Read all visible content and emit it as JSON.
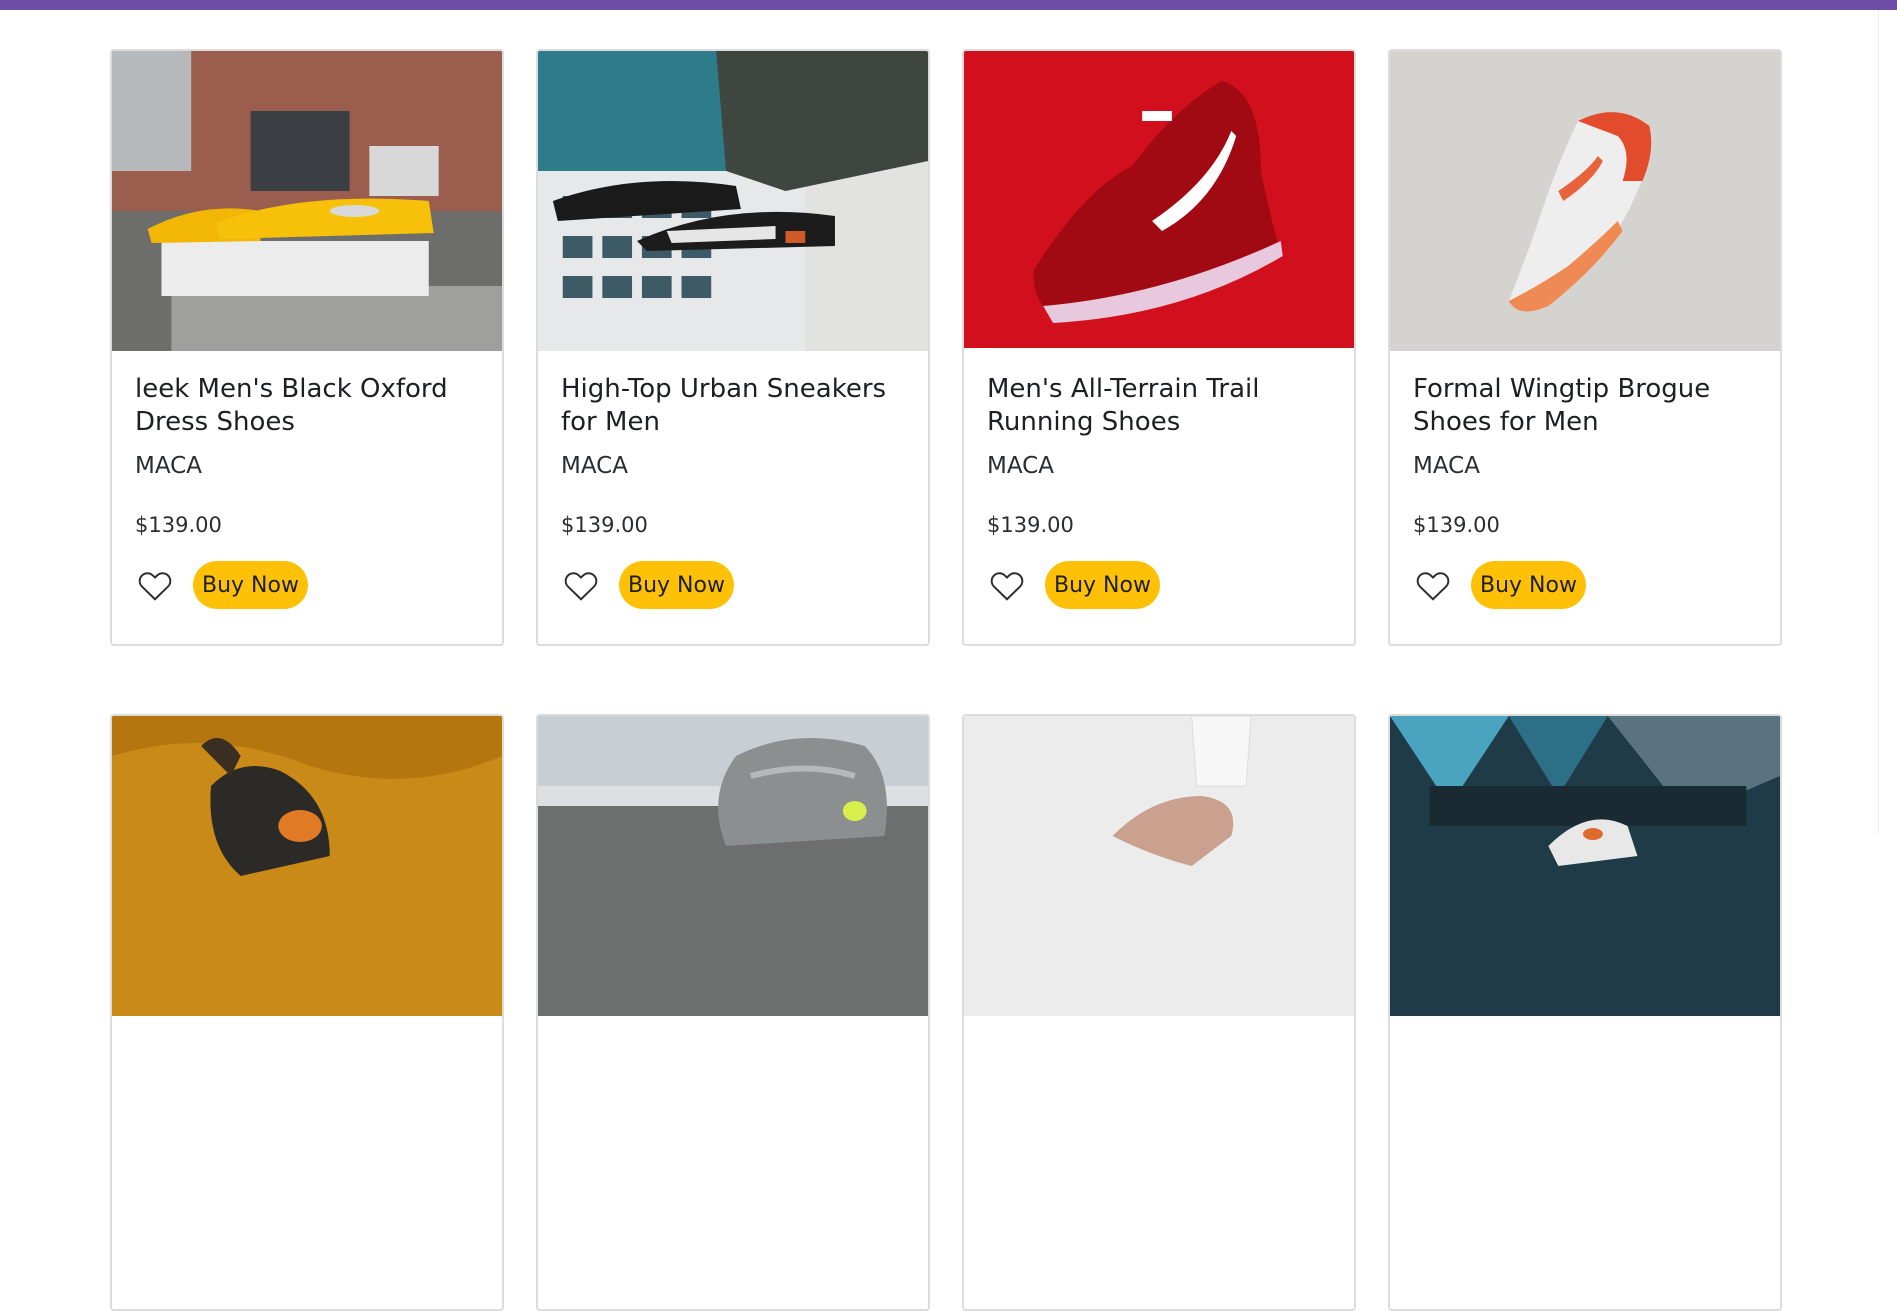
{
  "colors": {
    "topbar": "#6f4ca5",
    "button": "#ffc107",
    "card_border": "#dcdcdc"
  },
  "products": [
    {
      "title": "leek Men's Black Oxford Dress Shoes",
      "brand": "MACA",
      "price": "$139.00",
      "buy_label": "Buy Now",
      "image": "yellow-sneakers-on-box"
    },
    {
      "title": "High-Top Urban Sneakers for Men",
      "brand": "MACA",
      "price": "$139.00",
      "buy_label": "Buy Now",
      "image": "sneakers-on-feet-building"
    },
    {
      "title": "Men's All-Terrain Trail Running Shoes",
      "brand": "MACA",
      "price": "$139.00",
      "buy_label": "Buy Now",
      "image": "red-running-shoe"
    },
    {
      "title": "Formal Wingtip Brogue Shoes for Men",
      "brand": "MACA",
      "price": "$139.00",
      "buy_label": "Buy Now",
      "image": "orange-white-sneaker"
    },
    {
      "title": "",
      "brand": "",
      "price": "",
      "buy_label": "",
      "image": "shoe-on-mustard-fabric"
    },
    {
      "title": "",
      "brand": "",
      "price": "",
      "buy_label": "",
      "image": "grey-knit-shoe"
    },
    {
      "title": "",
      "brand": "",
      "price": "",
      "buy_label": "",
      "image": "hand-white-sleeve"
    },
    {
      "title": "",
      "brand": "",
      "price": "",
      "buy_label": "",
      "image": "sneaker-graffiti-wall"
    }
  ]
}
